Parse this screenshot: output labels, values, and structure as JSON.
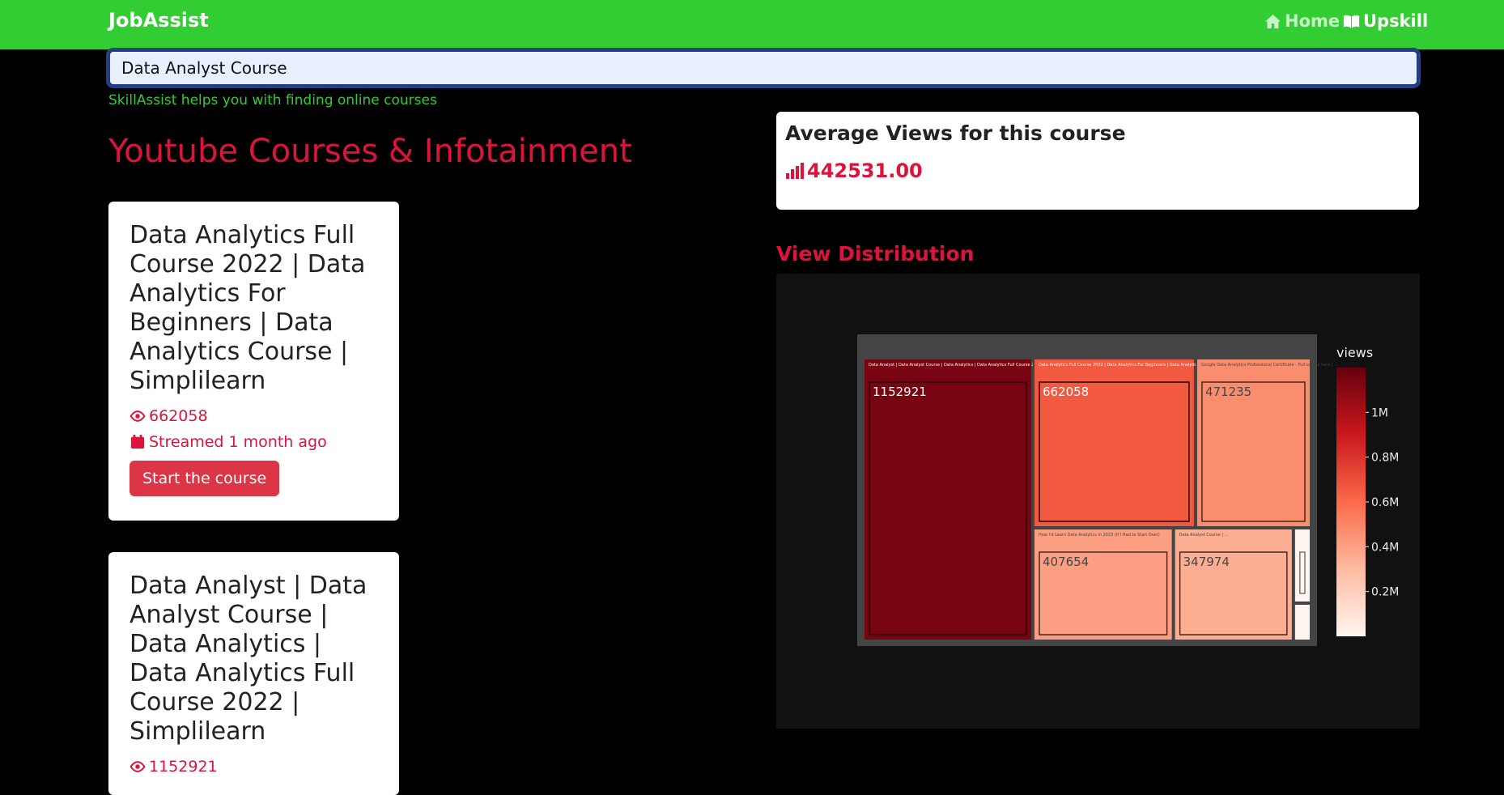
{
  "navbar": {
    "brand": "JobAssist",
    "links": [
      {
        "label": "Home",
        "icon": "home-icon"
      },
      {
        "label": "Upskill",
        "icon": "book-open-icon"
      }
    ]
  },
  "search": {
    "value": "Data Analyst Course"
  },
  "helper_text": "SkillAssist helps you with finding online courses",
  "section_title": "Youtube Courses & Infotainment",
  "courses": [
    {
      "title": "Data Analytics Full Course 2022 | Data Analytics For Beginners | Data Analytics Course | Simplilearn",
      "views": "662058",
      "streamed": "Streamed 1 month ago",
      "button_label": "Start the course"
    },
    {
      "title": "Data Analyst | Data Analyst Course | Data Analytics | Data Analytics Full Course 2022 | Simplilearn",
      "views": "1152921"
    }
  ],
  "average": {
    "title": "Average Views for this course",
    "value": "442531.00",
    "icon": "bar-chart-icon"
  },
  "distribution_title": "View Distribution",
  "colors": {
    "navbar": "#32cd32",
    "accent": "#dc143c",
    "button": "#dc3545"
  },
  "chart_data": {
    "type": "treemap",
    "colorbar_title": "views",
    "colorbar_ticks": [
      "0.2M",
      "0.4M",
      "0.6M",
      "0.8M",
      "1M"
    ],
    "color_scale": [
      "#fff5f0",
      "#fcbba1",
      "#fb6a4a",
      "#cb181d",
      "#67000d"
    ],
    "items": [
      {
        "label": "Data Analyst | Data Analyst Course | Data Analytics | Data Analytics Full Course 2022 | Simplilearn",
        "value": 1152921,
        "value_label": "1152921"
      },
      {
        "label": "Data Analytics Full Course 2022 | Data Analytics For Beginners | Data Analytics Course | Simplilearn",
        "value": 662058,
        "value_label": "662058"
      },
      {
        "label": "Google Data Analytics Professional Certificate - Full course here | ...",
        "value": 471235,
        "value_label": "471235"
      },
      {
        "label": "How I'd Learn Data Analytics in 2023 (If I Had to Start Over)",
        "value": 407654,
        "value_label": "407654"
      },
      {
        "label": "Data Analyst Course | ...",
        "value": 347974,
        "value_label": "347974"
      }
    ]
  }
}
